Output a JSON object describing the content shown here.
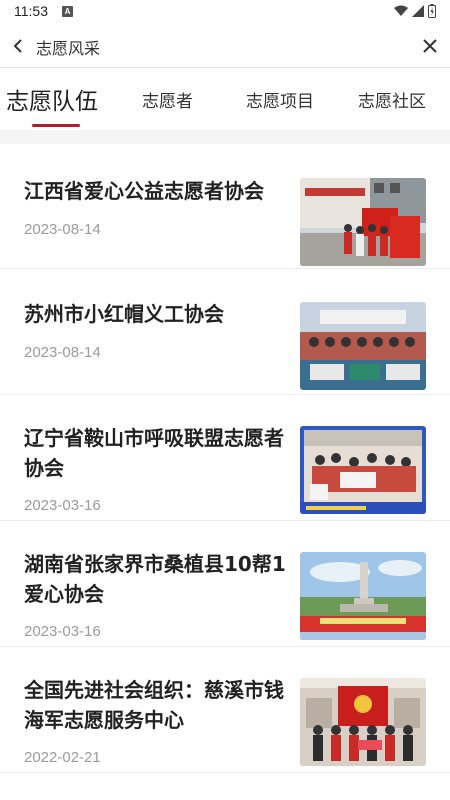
{
  "status_bar": {
    "time": "11:53",
    "notification_letter": "A",
    "icons": [
      "wifi-icon",
      "signal-icon",
      "battery-icon"
    ]
  },
  "app_bar": {
    "title": "志愿风采",
    "back_icon": "back-arrow-icon",
    "close_icon": "close-icon"
  },
  "tabs": [
    {
      "label": "志愿队伍",
      "active": true
    },
    {
      "label": "志愿者",
      "active": false
    },
    {
      "label": "志愿项目",
      "active": false
    },
    {
      "label": "志愿社区",
      "active": false
    }
  ],
  "colors": {
    "accent": "#b41c2c",
    "date": "#9b9b9b",
    "band": "#f5f5f5"
  },
  "items": [
    {
      "title": "江西省爱心公益志愿者协会",
      "date": "2023-08-14"
    },
    {
      "title": "苏州市小红帽义工协会",
      "date": "2023-08-14"
    },
    {
      "title": "辽宁省鞍山市呼吸联盟志愿者协会",
      "date": "2023-03-16"
    },
    {
      "title": "湖南省张家界市桑植县10帮1爱心协会",
      "date": "2023-03-16"
    },
    {
      "title": "全国先进社会组织：慈溪市钱海军志愿服务中心",
      "date": "2022-02-21"
    }
  ]
}
